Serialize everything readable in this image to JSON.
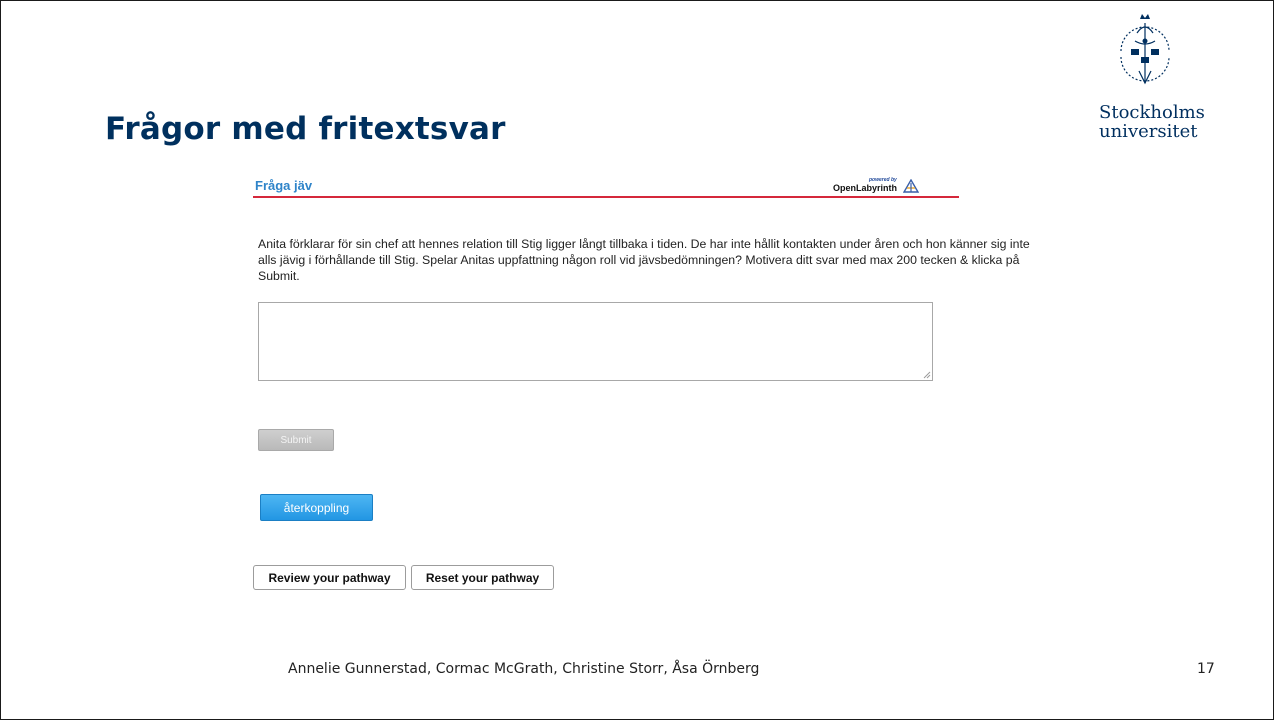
{
  "slide": {
    "title": "Frågor med fritextsvar",
    "logo": {
      "line1": "Stockholms",
      "line2": "universitet"
    },
    "footer": {
      "authors": "Annelie Gunnerstad, Cormac McGrath, Christine Storr, Åsa Örnberg",
      "page_number": "17"
    }
  },
  "openlabyrinth": {
    "node_title": "Fråga jäv",
    "powered_by": "powered by",
    "brand": "OpenLabyrinth",
    "question": "Anita förklarar för sin chef att hennes relation till Stig ligger långt tillbaka i tiden. De har inte hållit kontakten under åren och hon känner sig inte alls jävig i förhållande till Stig. Spelar Anitas uppfattning någon roll vid jävsbedömningen? Motivera ditt svar med max 200 tecken & klicka på Submit.",
    "answer_value": "",
    "submit_label": "Submit",
    "feedback_label": "återkoppling",
    "review_label": "Review your pathway",
    "reset_label": "Reset your pathway"
  },
  "colors": {
    "title": "#00305e",
    "header_rule": "#d5283b",
    "node_title": "#2f84c9",
    "feedback_button": "#2296e3"
  }
}
